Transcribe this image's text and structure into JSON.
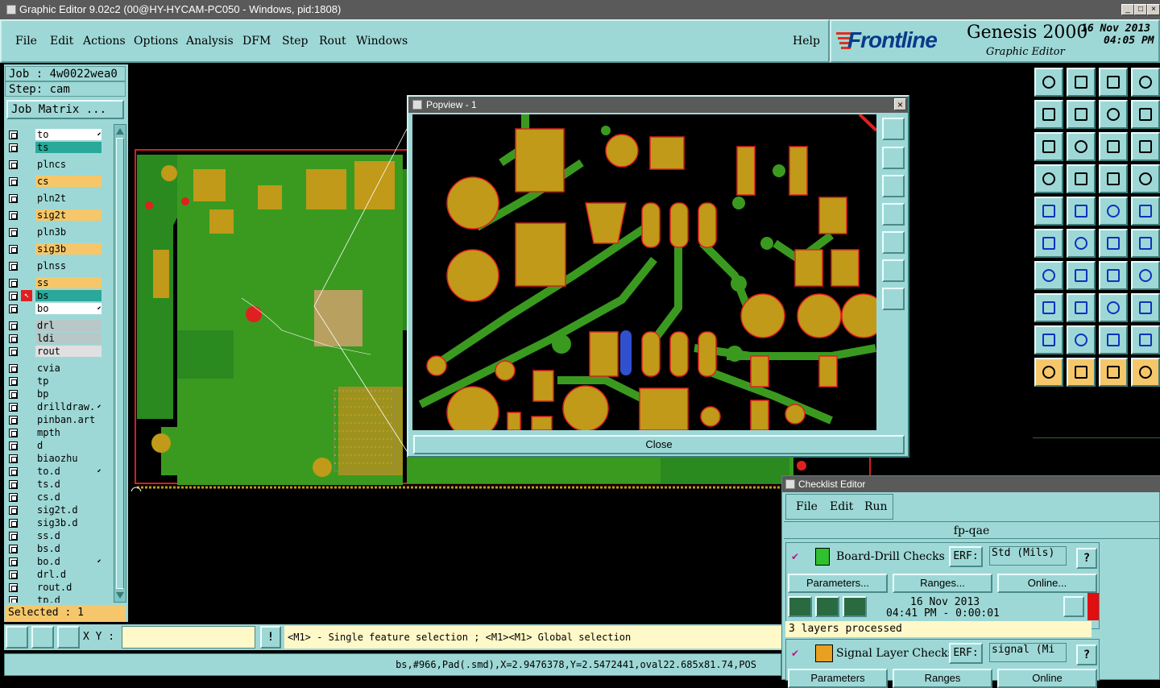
{
  "window": {
    "title": "Graphic Editor 9.02c2 (00@HY-HYCAM-PC050 - Windows, pid:1808)"
  },
  "menu": {
    "items": [
      "File",
      "Edit",
      "Actions",
      "Options",
      "Analysis",
      "DFM",
      "Step",
      "Rout",
      "Windows"
    ],
    "help": "Help"
  },
  "brand": {
    "logo": "Frontline",
    "product": "Genesis 2000",
    "subtitle": "Graphic Editor",
    "date": "16 Nov 2013",
    "time": "04:05 PM"
  },
  "job": {
    "job_label": "Job : 4w0022wea0",
    "step_label": "Step: cam",
    "matrix_button": "Job Matrix ..."
  },
  "layers": [
    {
      "name": "to",
      "color": "#ffffff",
      "arrow": true
    },
    {
      "name": "ts",
      "color": "#2aa89a"
    },
    {
      "name": "plncs",
      "color": "#9ed8d6"
    },
    {
      "name": "cs",
      "color": "#f5c76a"
    },
    {
      "name": "pln2t",
      "color": "#9ed8d6"
    },
    {
      "name": "sig2t",
      "color": "#f5c76a"
    },
    {
      "name": "pln3b",
      "color": "#9ed8d6"
    },
    {
      "name": "sig3b",
      "color": "#f5c76a"
    },
    {
      "name": "plnss",
      "color": "#9ed8d6"
    },
    {
      "name": "ss",
      "color": "#f5c76a"
    },
    {
      "name": "bs",
      "color": "#2aa89a",
      "work": true
    },
    {
      "name": "bo",
      "color": "#ffffff",
      "arrow": true
    },
    {
      "name": "drl",
      "color": "#b8c8c8"
    },
    {
      "name": "ldi",
      "color": "#b8c8c8"
    },
    {
      "name": "rout",
      "color": "#e0e0e0"
    },
    {
      "name": "cvia",
      "color": "#9ed8d6"
    },
    {
      "name": "tp",
      "color": "#9ed8d6"
    },
    {
      "name": "bp",
      "color": "#9ed8d6"
    },
    {
      "name": "drilldraw.",
      "color": "#9ed8d6",
      "arrow": true
    },
    {
      "name": "pinban.art",
      "color": "#9ed8d6"
    },
    {
      "name": "mpth",
      "color": "#9ed8d6"
    },
    {
      "name": "d",
      "color": "#9ed8d6"
    },
    {
      "name": "biaozhu",
      "color": "#9ed8d6"
    },
    {
      "name": "to.d",
      "color": "#9ed8d6",
      "arrow": true
    },
    {
      "name": "ts.d",
      "color": "#9ed8d6"
    },
    {
      "name": "cs.d",
      "color": "#9ed8d6"
    },
    {
      "name": "sig2t.d",
      "color": "#9ed8d6"
    },
    {
      "name": "sig3b.d",
      "color": "#9ed8d6"
    },
    {
      "name": "ss.d",
      "color": "#9ed8d6"
    },
    {
      "name": "bs.d",
      "color": "#9ed8d6"
    },
    {
      "name": "bo.d",
      "color": "#9ed8d6",
      "arrow": true
    },
    {
      "name": "drl.d",
      "color": "#9ed8d6"
    },
    {
      "name": "rout.d",
      "color": "#9ed8d6"
    },
    {
      "name": "tp.d",
      "color": "#9ed8d6"
    }
  ],
  "selected": "Selected : 1",
  "bottom": {
    "xy_label": "X Y :",
    "xy_value": "",
    "hint": "<M1> - Single feature selection ; <M1><M1> Global selection",
    "status": "bs,#966,Pad(.smd),X=2.9476378,Y=2.5472441,oval22.685x81.74,POS"
  },
  "popview": {
    "title": "Popview - 1",
    "close_button": "Close"
  },
  "tools": [
    "frame-icon",
    "frame-icon",
    "home-icon",
    "grid-icon",
    "pan-left-icon",
    "pan-right-icon",
    "return-icon",
    "step-icon",
    "zoom-fit-icon",
    "center-icon",
    "ratio-icon",
    "help-icon",
    "measure-icon",
    "grid-display-icon",
    "layers-icon",
    "layers-icon",
    "pad-icon",
    "line-icon",
    "ruler-icon",
    "dot-icon",
    "net-icon",
    "cross-icon",
    "arc-icon",
    "arc-icon",
    "angle-icon",
    "line-icon",
    "rotate-icon",
    "feature-icon",
    "snap-icon",
    "minus-icon",
    "dimension-icon",
    "shapes-icon",
    "triangle-icon",
    "triangle-icon",
    "triangle-icon",
    "triangle-icon",
    "pointer-icon",
    "select-icon",
    "select-icon",
    "edit-icon"
  ],
  "checklist": {
    "title": "Checklist Editor",
    "menu": [
      "File",
      "Edit",
      "Run"
    ],
    "name": "fp-qae",
    "checks": [
      {
        "name": "Board-Drill Checks",
        "erf_label": "ERF:",
        "erf_value": "Std (Mils)",
        "help": "?",
        "buttons": [
          "Parameters...",
          "Ranges...",
          "Online..."
        ],
        "date": "16 Nov 2013",
        "time": "04:41 PM - 0:00:01",
        "status": "3 layers processed"
      },
      {
        "name": "Signal Layer Checks",
        "erf_label": "ERF:",
        "erf_value": "signal (Mi",
        "help": "?",
        "buttons": [
          "Parameters",
          "Ranges",
          "Online"
        ]
      }
    ]
  }
}
